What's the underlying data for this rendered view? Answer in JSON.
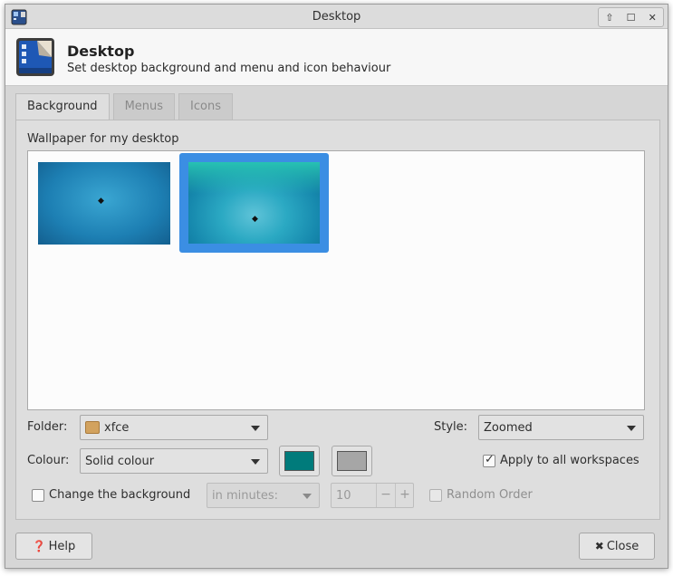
{
  "window": {
    "title": "Desktop"
  },
  "header": {
    "title": "Desktop",
    "subtitle": "Set desktop background and menu and icon behaviour"
  },
  "tabs": [
    {
      "label": "Background",
      "active": true
    },
    {
      "label": "Menus",
      "active": false
    },
    {
      "label": "Icons",
      "active": false
    }
  ],
  "background": {
    "wallpaper_label": "Wallpaper for my desktop",
    "wallpapers": [
      {
        "name": "xfce-blue",
        "selected": false
      },
      {
        "name": "xfce-teal",
        "selected": true
      }
    ],
    "folder_label": "Folder:",
    "folder_value": "xfce",
    "style_label": "Style:",
    "style_value": "Zoomed",
    "colour_label": "Colour:",
    "colour_value": "Solid colour",
    "primary_colour": "#007b7b",
    "secondary_colour": "#a6a6a6",
    "apply_all_label": "Apply to all workspaces",
    "apply_all_checked": true,
    "change_bg_label": "Change the background",
    "change_bg_checked": false,
    "interval_unit": "in minutes:",
    "interval_value": "10",
    "random_order_label": "Random Order",
    "random_order_checked": false
  },
  "buttons": {
    "help": "Help",
    "close": "Close"
  }
}
